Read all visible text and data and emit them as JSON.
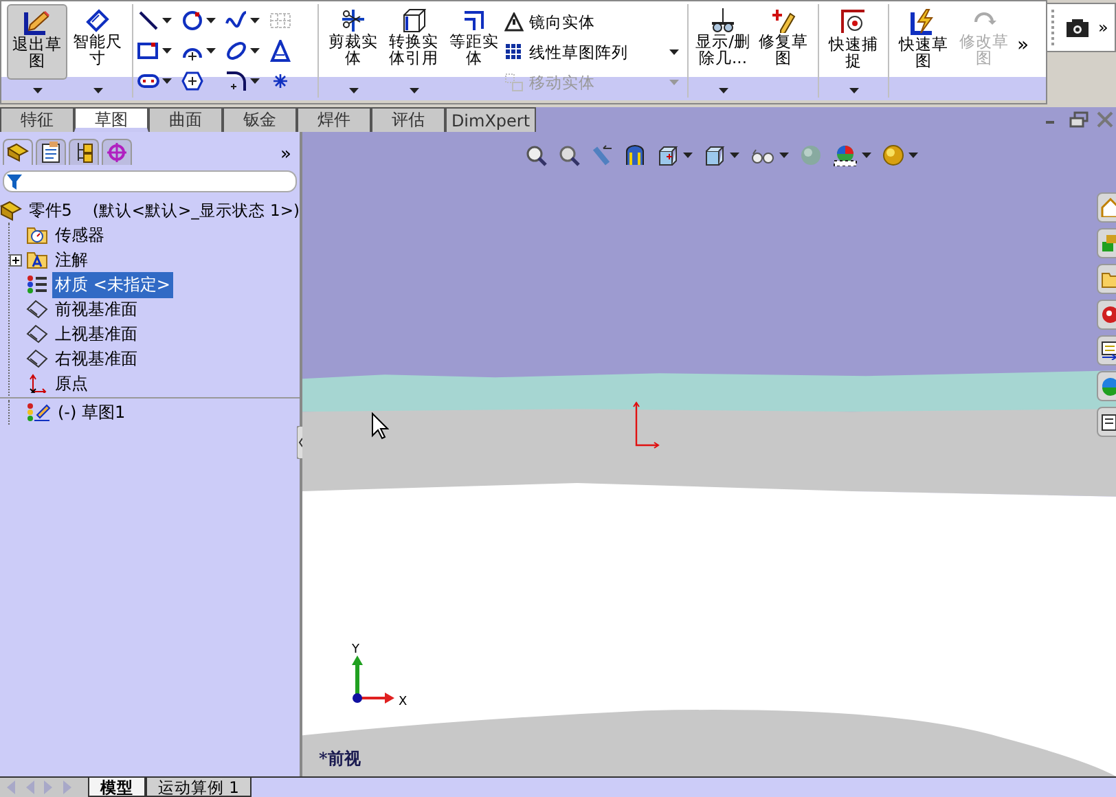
{
  "toolbar": {
    "sketch_buttons": [
      {
        "label": "退出草图",
        "pressed": true,
        "disabled": false,
        "dropdown": true
      },
      {
        "label": "智能尺寸",
        "pressed": false,
        "disabled": false,
        "dropdown": true
      }
    ],
    "edit_buttons": [
      {
        "label": "剪裁实体",
        "pressed": false,
        "disabled": false,
        "dropdown": true
      },
      {
        "label": "转换实体引用",
        "pressed": false,
        "disabled": false,
        "dropdown": true
      },
      {
        "label": "等距实体",
        "pressed": false,
        "disabled": false,
        "dropdown": false
      }
    ],
    "pattern_tools": [
      {
        "label": "镜向实体",
        "disabled": false,
        "dropdown": false
      },
      {
        "label": "线性草图阵列",
        "disabled": false,
        "dropdown": true
      },
      {
        "label": "移动实体",
        "disabled": true,
        "dropdown": true
      }
    ],
    "relation_buttons": [
      {
        "label": "显示/删除几...",
        "pressed": false,
        "disabled": false,
        "dropdown": true
      },
      {
        "label": "修复草图",
        "pressed": false,
        "disabled": false,
        "dropdown": false
      }
    ],
    "snap_buttons": [
      {
        "label": "快速捕捉",
        "pressed": false,
        "disabled": false,
        "dropdown": true
      }
    ],
    "quick_buttons": [
      {
        "label": "快速草图",
        "pressed": false,
        "disabled": false,
        "dropdown": false
      },
      {
        "label": "修改草图",
        "pressed": false,
        "disabled": true,
        "dropdown": false
      }
    ],
    "overflow": "»",
    "side_overflow": "»"
  },
  "tabs": [
    {
      "label": "特征",
      "selected": false
    },
    {
      "label": "草图",
      "selected": true
    },
    {
      "label": "曲面",
      "selected": false
    },
    {
      "label": "钣金",
      "selected": false
    },
    {
      "label": "焊件",
      "selected": false
    },
    {
      "label": "评估",
      "selected": false
    },
    {
      "label": "DimXpert",
      "selected": false
    }
  ],
  "panel": {
    "overflow": "»",
    "tree": {
      "label": "零件5",
      "configuration": "(默认<默认>_显示状态 1>)",
      "children": [
        {
          "label": "传感器",
          "kind": "sensor",
          "selected": false
        },
        {
          "label": "注解",
          "kind": "annotation",
          "selected": false,
          "expanded": false
        },
        {
          "label": "材质 <未指定>",
          "kind": "material",
          "selected": true
        },
        {
          "label": "前视基准面",
          "kind": "plane",
          "selected": false
        },
        {
          "label": "上视基准面",
          "kind": "plane",
          "selected": false
        },
        {
          "label": "右视基准面",
          "kind": "plane",
          "selected": false
        },
        {
          "label": "原点",
          "kind": "origin",
          "selected": false
        },
        {
          "label": "(-) 草图1",
          "kind": "sketch",
          "selected": false
        }
      ]
    }
  },
  "viewport": {
    "axis_y": "Y",
    "axis_x": "X",
    "view_name": "*前视"
  },
  "bottom_tabs": [
    {
      "label": "模型",
      "selected": true
    },
    {
      "label": "运动算例 1",
      "selected": false
    }
  ]
}
